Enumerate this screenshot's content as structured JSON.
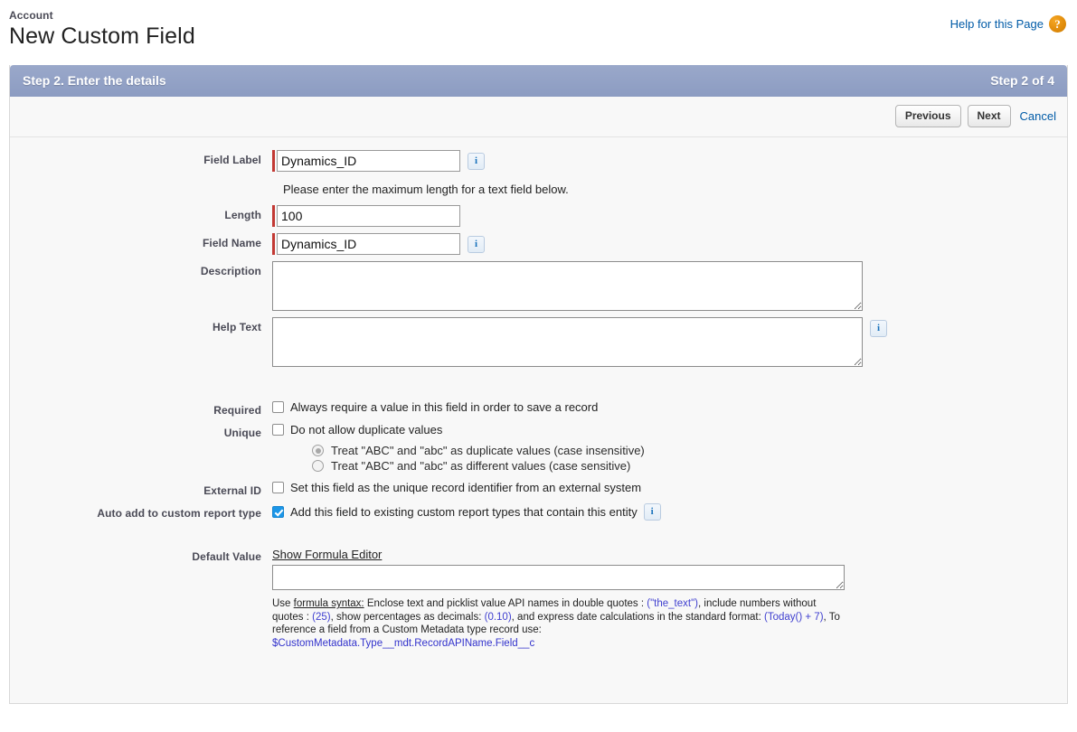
{
  "header": {
    "object_name": "Account",
    "title": "New Custom Field",
    "help_link": "Help for this Page",
    "help_icon": "question-mark-icon"
  },
  "wizard": {
    "step_title": "Step 2. Enter the details",
    "step_counter": "Step 2 of 4",
    "banner_color": "#96a4c8"
  },
  "actions": {
    "previous": "Previous",
    "next": "Next",
    "cancel": "Cancel"
  },
  "form": {
    "field_label": {
      "label": "Field Label",
      "value": "Dynamics_ID",
      "placeholder": "",
      "required": true,
      "info_icon": "info-icon"
    },
    "length_hint": "Please enter the maximum length for a text field below.",
    "length": {
      "label": "Length",
      "value": "100",
      "placeholder": "",
      "required": true
    },
    "field_name": {
      "label": "Field Name",
      "value": "Dynamics_ID",
      "placeholder": "",
      "required": true,
      "info_icon": "info-icon"
    },
    "description": {
      "label": "Description",
      "value": "",
      "placeholder": ""
    },
    "help_text": {
      "label": "Help Text",
      "value": "",
      "placeholder": "",
      "info_icon": "info-icon"
    },
    "required_option": {
      "label": "Required",
      "text": "Always require a value in this field in order to save a record",
      "checked": false
    },
    "unique_option": {
      "label": "Unique",
      "text": "Do not allow duplicate values",
      "checked": false
    },
    "case_options": [
      {
        "text": "Treat \"ABC\" and \"abc\" as duplicate values (case insensitive)",
        "selected": true,
        "disabled": true
      },
      {
        "text": "Treat \"ABC\" and \"abc\" as different values (case sensitive)",
        "selected": false,
        "disabled": true
      }
    ],
    "external_id": {
      "label": "External ID",
      "text": "Set this field as the unique record identifier from an external system",
      "checked": false
    },
    "auto_add_report": {
      "label": "Auto add to custom report type",
      "text": "Add this field to existing custom report types that contain this entity",
      "checked": true,
      "info_icon": "info-icon"
    },
    "default_value": {
      "label": "Default Value",
      "formula_editor_link": "Show Formula Editor",
      "value": "",
      "placeholder": ""
    },
    "syntax_help": {
      "prefix": "Use ",
      "link": "formula syntax:",
      "part1": " Enclose text and picklist value API names in double quotes : ",
      "code1": "(\"the_text\")",
      "part2": ", include numbers without quotes : ",
      "code2": "(25)",
      "part3": ", show percentages as decimals: ",
      "code3": "(0.10)",
      "part4": ", and express date calculations in the standard format: ",
      "code4": "(Today() + 7)",
      "part5": ", To reference a field from a Custom Metadata type record use:",
      "code5": "$CustomMetadata.Type__mdt.RecordAPIName.Field__c"
    }
  }
}
